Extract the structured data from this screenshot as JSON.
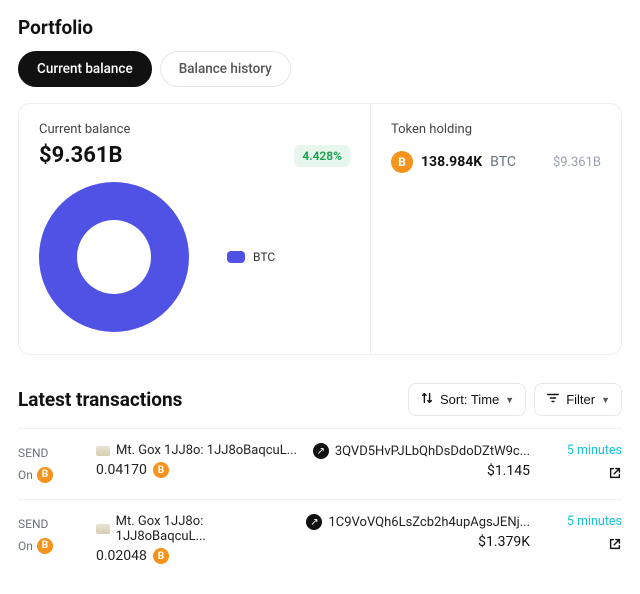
{
  "header": {
    "title": "Portfolio"
  },
  "tabs": {
    "current": "Current balance",
    "history": "Balance history"
  },
  "balance": {
    "label": "Current balance",
    "value": "$9.361B",
    "change_pct": "4.428%"
  },
  "chart_data": {
    "type": "pie",
    "title": "Current balance",
    "series": [
      {
        "name": "BTC",
        "value": 100,
        "color": "#4f52e5"
      }
    ],
    "legend": [
      "BTC"
    ]
  },
  "holdings": {
    "label": "Token holding",
    "items": [
      {
        "icon": "bitcoin",
        "amount": "138.984K",
        "symbol": "BTC",
        "usd": "$9.361B"
      }
    ]
  },
  "transactions": {
    "title": "Latest transactions",
    "sort_label": "Sort: Time",
    "filter_label": "Filter",
    "rows": [
      {
        "type": "SEND",
        "on_label": "On",
        "from": "Mt. Gox 1JJ8o: 1JJ8oBaqcuL...",
        "amount": "0.04170",
        "to": "3QVD5HvPJLbQhDsDdoDZtW9c...",
        "usd": "$1.145",
        "time": "5 minutes"
      },
      {
        "type": "SEND",
        "on_label": "On",
        "from": "Mt. Gox 1JJ8o: 1JJ8oBaqcuL...",
        "amount": "0.02048",
        "to": "1C9VoVQh6LsZcb2h4upAgsJENj...",
        "usd": "$1.379K",
        "time": "5 minutes"
      }
    ]
  },
  "glyphs": {
    "btc": "B"
  }
}
